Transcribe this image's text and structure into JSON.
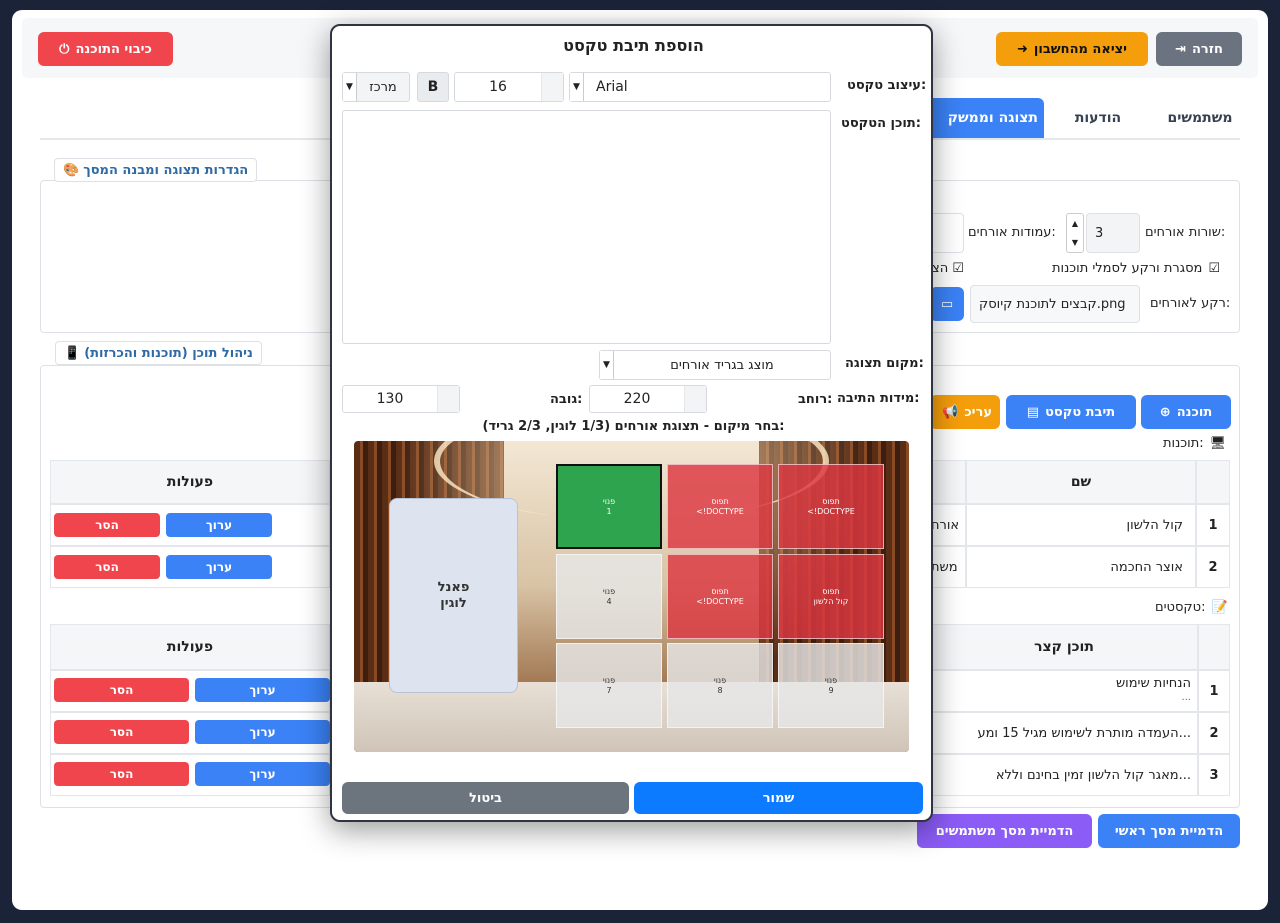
{
  "top": {
    "back": "חזרה",
    "logout": "יציאה מהחשבון",
    "shutdown": "כיבוי התוכנה"
  },
  "tabs": [
    "משתמשים",
    "הודעות",
    "תצוגה וממשק"
  ],
  "display_settings": {
    "legend": "הגדרות תצוגה ומבנה המסך",
    "guest_rows_label": "שורות אורחים:",
    "guest_rows_value": "3",
    "guest_cols_label": "עמודות אורחים:",
    "frame_checkbox": "מסגרת ורקע לסמלי תוכנות",
    "partial_checkbox": "הצ",
    "guest_bg_label": "רקע לאורחים:",
    "guest_bg_value": "קבצים לתוכנת קיוסק.png"
  },
  "content_mgmt": {
    "legend": "ניהול תוכן (תוכנות והכרזות)",
    "add_program": "תוכנה",
    "add_textbox": "תיבת טקסט",
    "edit_partial": "עריכ",
    "programs_label": "תוכנות:",
    "programs_header_name": "שם",
    "programs": [
      {
        "num": "1",
        "name": "קול הלשון",
        "partial": "אורח"
      },
      {
        "num": "2",
        "name": "אוצר החכמה",
        "partial": "משת"
      }
    ],
    "texts_label": "טקסטים:",
    "texts_header": "תוכן קצר",
    "texts": [
      {
        "num": "1",
        "text": "הנחיות שימוש",
        "sub": "..."
      },
      {
        "num": "2",
        "text": "העמדה מותרת לשימוש מגיל 15 ומע..."
      },
      {
        "num": "3",
        "text": "מאגר קול הלשון זמין בחינם וללא..."
      }
    ],
    "actions_header": "פעולות",
    "edit": "ערוך",
    "remove": "הסר"
  },
  "bottom": {
    "preview_main": "הדמיית מסך ראשי",
    "preview_users": "הדמיית מסך משתמשים"
  },
  "modal": {
    "title": "הוספת תיבת טקסט",
    "format_label": "עיצוב טקסט:",
    "font": "Arial",
    "size": "16",
    "bold": "B",
    "align": "מרכז",
    "content_label": "תוכן הטקסט:",
    "position_label": "מקום תצוגה:",
    "position_value": "מוצג בגריד אורחים",
    "dims_label": "מידות התיבה:",
    "width_label": "רוחב:",
    "width_value": "220",
    "height_label": "גובה:",
    "height_value": "130",
    "grid_caption": "בחר מיקום - תצוגת אורחים (1/3 לוגין, 2/3 גריד):",
    "login_panel": [
      "פאנל",
      "לוגין"
    ],
    "cells": [
      {
        "l1": "פנוי",
        "l2": "1",
        "state": "green"
      },
      {
        "l1": "תפוס",
        "l2": "<!DOCTYPE",
        "state": "red"
      },
      {
        "l1": "תפוס",
        "l2": "<!DOCTYPE",
        "state": "red"
      },
      {
        "l1": "פנוי",
        "l2": "4",
        "state": "gray"
      },
      {
        "l1": "תפוס",
        "l2": "<!DOCTYPE",
        "state": "red"
      },
      {
        "l1": "תפוס",
        "l2": "קול הלשון",
        "state": "red"
      },
      {
        "l1": "פנוי",
        "l2": "7",
        "state": "gray"
      },
      {
        "l1": "פנוי",
        "l2": "8",
        "state": "gray"
      },
      {
        "l1": "פנוי",
        "l2": "9",
        "state": "gray"
      }
    ],
    "save": "שמור",
    "cancel": "ביטול"
  }
}
